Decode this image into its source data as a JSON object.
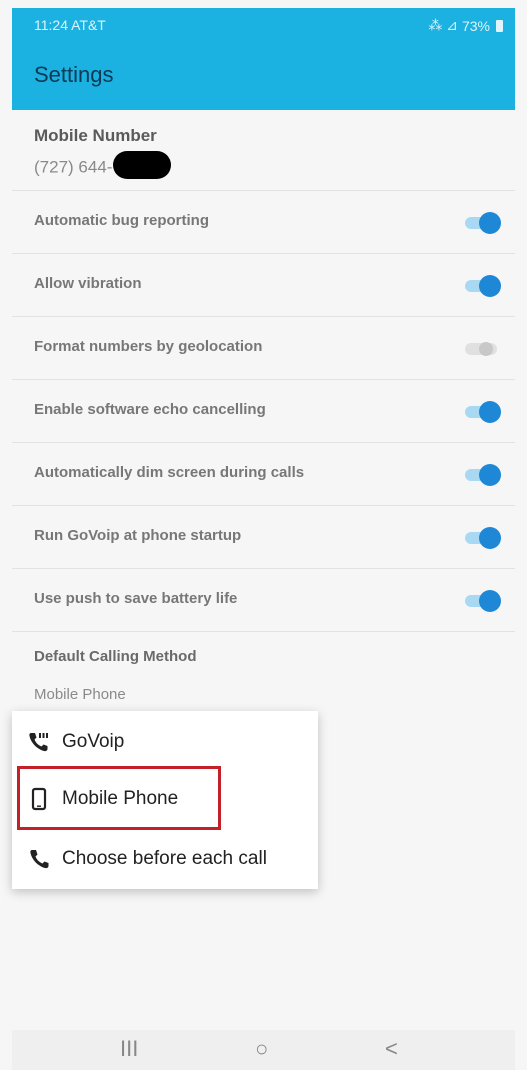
{
  "status_bar": {
    "time": "11:24 AT&T",
    "signal": "⁂ ⊿",
    "battery": "73%"
  },
  "app_bar": {
    "title": "Settings"
  },
  "mobile_number": {
    "label": "Mobile Number",
    "value": "(727) 644-"
  },
  "settings": [
    {
      "label": "Automatic bug reporting",
      "enabled": true
    },
    {
      "label": "Allow vibration",
      "enabled": true
    },
    {
      "label": "Format numbers by geolocation",
      "enabled": false
    },
    {
      "label": "Enable software echo cancelling",
      "enabled": true
    },
    {
      "label": "Automatically dim screen during calls",
      "enabled": true
    },
    {
      "label": "Run GoVoip at phone startup",
      "enabled": true
    },
    {
      "label": "Use push to save battery life",
      "enabled": true
    }
  ],
  "default_calling": {
    "label": "Default Calling Method",
    "value": "Mobile Phone"
  },
  "popup": {
    "options": [
      {
        "label": "GoVoip",
        "icon": "voip-phone-icon"
      },
      {
        "label": "Mobile Phone",
        "icon": "mobile-phone-icon"
      },
      {
        "label": "Choose before each call",
        "icon": "phone-icon"
      }
    ]
  },
  "nav_bar": {
    "recents": "III",
    "home": "○",
    "back": "<"
  },
  "colors": {
    "accent": "#1bb1e1",
    "toggle_on": "#1e88d6",
    "highlight": "#c4202a"
  }
}
